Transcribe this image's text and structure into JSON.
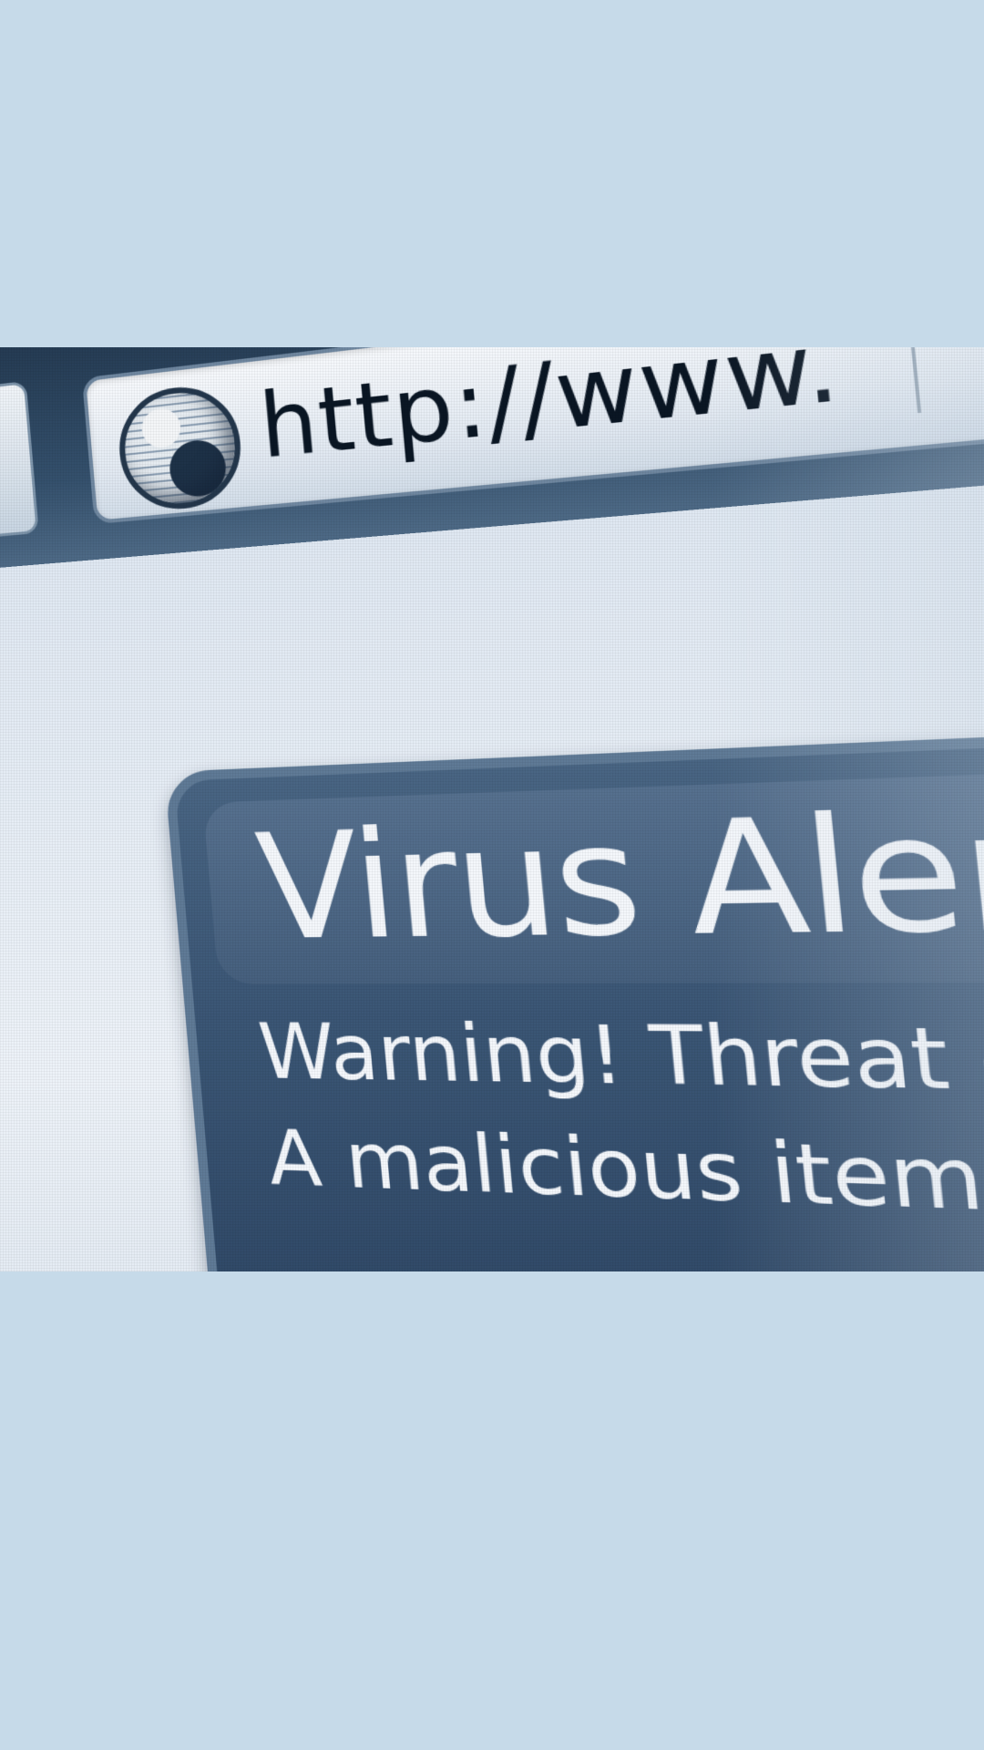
{
  "photo": {
    "address_bar": {
      "url_text": "http://www.",
      "icon": "globe-icon"
    },
    "alert": {
      "title": "Virus Alert!",
      "line1": "Warning! Threat detected!",
      "line2": "A malicious item has been dete"
    }
  },
  "colors": {
    "background": "#c6dae9",
    "toolbar": "#2b4259",
    "alert_box": "#3b5675",
    "alert_text": "#f4f7fb"
  }
}
